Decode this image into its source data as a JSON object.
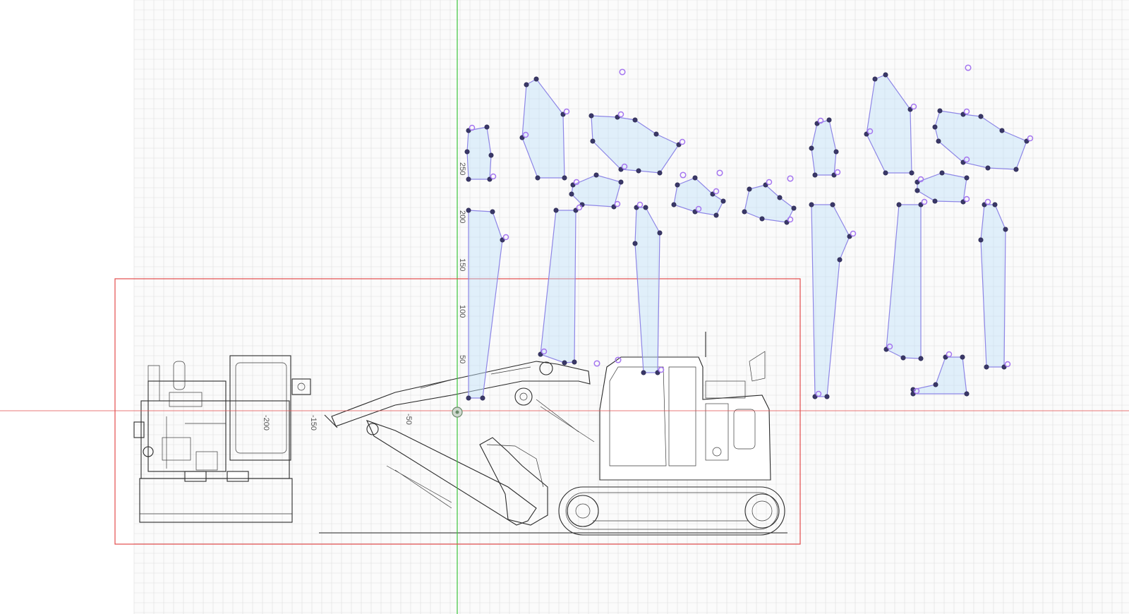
{
  "canvas": {
    "background": "#ffffff",
    "grid_color": "#dedede",
    "x_axis_color": "#e24c4c",
    "y_axis_color": "#3cc53c",
    "selection_color": "#e24c4c",
    "polygon_fill": "#bee1f8",
    "polygon_stroke": "#8e86e6",
    "node_color": "#3a3868",
    "handle_color": "#a576f0"
  },
  "axis": {
    "y_ticks": [
      "250",
      "200",
      "150",
      "100",
      "50"
    ],
    "x_ticks": [
      "-200",
      "-150",
      "-50"
    ]
  },
  "drawing": {
    "subject": "excavator-line-art",
    "views": [
      "rear-view",
      "side-view"
    ]
  },
  "polygons_count": 22,
  "icons": {
    "origin": "origin-handle-icon"
  }
}
